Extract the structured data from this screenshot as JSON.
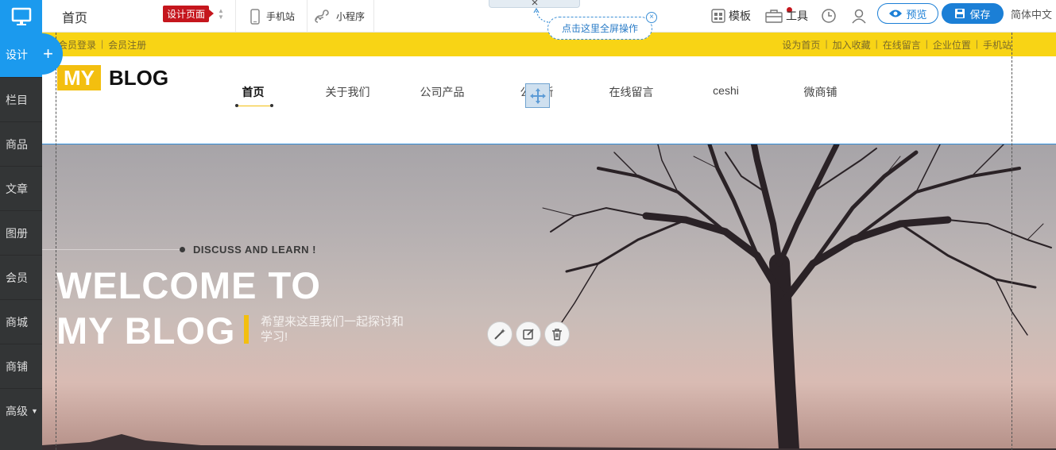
{
  "sidebar": {
    "logo_icon": "monitor-icon",
    "design_label": "设计",
    "add_label": "+",
    "items": [
      {
        "label": "栏目"
      },
      {
        "label": "商品"
      },
      {
        "label": "文章"
      },
      {
        "label": "图册"
      },
      {
        "label": "会员"
      },
      {
        "label": "商城"
      },
      {
        "label": "商铺"
      },
      {
        "label": "高级"
      }
    ]
  },
  "toolbar": {
    "page_name": "首页",
    "page_badge": "设计页面",
    "mobile_label": "手机站",
    "mini_program_label": "小程序",
    "template_label": "模板",
    "tools_label": "工具",
    "preview_label": "预览",
    "save_label": "保存",
    "language_label": "简体中文"
  },
  "fullscreen_tip": "点击这里全屏操作",
  "site": {
    "topbar_left": [
      "会员登录",
      "会员注册"
    ],
    "topbar_right": [
      "设为首页",
      "加入收藏",
      "在线留言",
      "企业位置",
      "手机站"
    ],
    "logo_my": "MY",
    "logo_blog": "BLOG",
    "nav": [
      "首页",
      "关于我们",
      "公司产品",
      "公司新",
      "在线留言",
      "ceshi",
      "微商铺"
    ],
    "hero": {
      "kicker": "DISCUSS AND LEARN !",
      "title_line1": "WELCOME TO",
      "title_line2": "MY BLOG",
      "subtitle": "希望来这里我们一起探讨和学习!"
    }
  },
  "colors": {
    "accent_blue": "#1b9aee",
    "brand_yellow": "#f8d415",
    "logo_yellow": "#f3bf0f",
    "badge_red": "#c5161d",
    "sidebar_dark": "#333536"
  }
}
